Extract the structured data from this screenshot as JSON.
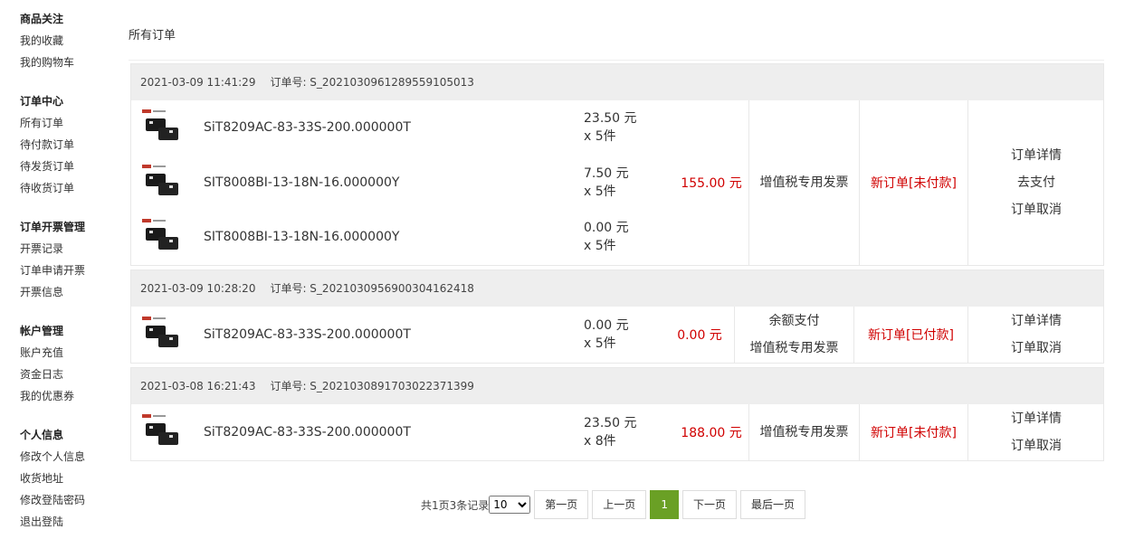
{
  "sidebar": {
    "groups": [
      {
        "title": "商品关注",
        "items": [
          "我的收藏",
          "我的购物车"
        ]
      },
      {
        "title": "订单中心",
        "items": [
          "所有订单",
          "待付款订单",
          "待发货订单",
          "待收货订单"
        ]
      },
      {
        "title": "订单开票管理",
        "items": [
          "开票记录",
          "订单申请开票",
          "开票信息"
        ]
      },
      {
        "title": "帐户管理",
        "items": [
          "账户充值",
          "资金日志",
          "我的优惠券"
        ]
      },
      {
        "title": "个人信息",
        "items": [
          "修改个人信息",
          "收货地址",
          "修改登陆密码",
          "退出登陆"
        ]
      }
    ]
  },
  "main": {
    "title": "所有订单"
  },
  "orders": [
    {
      "time": "2021-03-09 11:41:29",
      "order_no": "订单号: S_20210309612895591050l3",
      "items": [
        {
          "name": "SiT8209AC-83-33S-200.000000T",
          "price": "23.50 元",
          "qty": "x 5件"
        },
        {
          "name": "SIT8008BI-13-18N-16.000000Y",
          "price": "7.50 元",
          "qty": "x 5件"
        },
        {
          "name": "SIT8008BI-13-18N-16.000000Y",
          "price": "0.00 元",
          "qty": "x 5件"
        }
      ],
      "total": "155.00 元",
      "payment": [
        "增值税专用发票"
      ],
      "status": "新订单[未付款]",
      "actions": [
        "订单详情",
        "去支付",
        "订单取消"
      ]
    },
    {
      "time": "2021-03-09 10:28:20",
      "order_no": "订单号: S_20210309569003041624l8",
      "items": [
        {
          "name": "SiT8209AC-83-33S-200.000000T",
          "price": "0.00 元",
          "qty": "x 5件"
        }
      ],
      "total": "0.00 元",
      "payment": [
        "余额支付",
        "增值税专用发票"
      ],
      "status": "新订单[已付款]",
      "actions": [
        "订单详情",
        "订单取消"
      ]
    },
    {
      "time": "2021-03-08 16:21:43",
      "order_no": "订单号: S_20210308917030223713­99",
      "items": [
        {
          "name": "SiT8209AC-83-33S-200.000000T",
          "price": "23.50 元",
          "qty": "x 8件"
        }
      ],
      "total": "188.00 元",
      "payment": [
        "增值税专用发票"
      ],
      "status": "新订单[未付款]",
      "actions": [
        "订单详情",
        "订单取消"
      ]
    }
  ],
  "pager": {
    "info": "共1页3条记录",
    "page_size": "10",
    "first": "第一页",
    "prev": "上一页",
    "current": "1",
    "next": "下一页",
    "last": "最后一页"
  }
}
